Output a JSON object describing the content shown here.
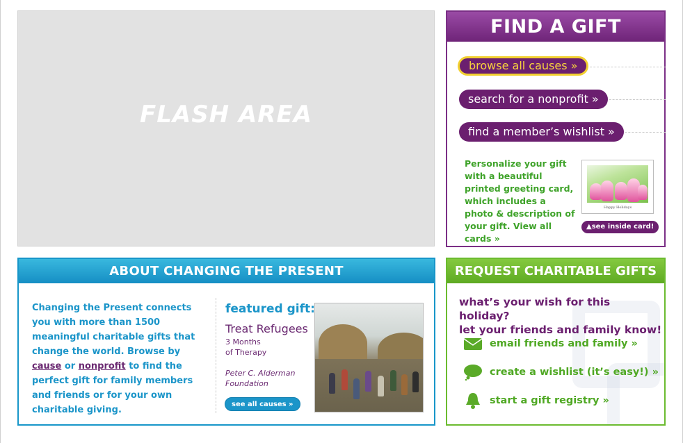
{
  "flash": {
    "label": "FLASH AREA"
  },
  "find_gift": {
    "title": "FIND A GIFT",
    "buttons": [
      "browse all causes »",
      "search for a nonprofit »",
      "find a member’s wishlist »"
    ],
    "card_text": "Personalize your gift with a beautiful printed greeting card, which includes a photo & description of your gift.",
    "card_link": "View all cards »",
    "card_caption": "Happy Holidays",
    "inside_card_label": "▲see inside card!"
  },
  "about": {
    "title": "ABOUT CHANGING THE PRESENT",
    "text_part1": "Changing the Present connects you with more than 1500 meaningful charitable gifts that change the world. Browse by",
    "link_cause": "cause",
    "text_or": "or",
    "link_nonprofit": "nonprofit",
    "text_part2": "to find the perfect gift for family members and friends or for your own charitable giving.",
    "featured_label": "featured gift:",
    "featured_name": "Treat Refugees",
    "featured_sub1": "3 Months",
    "featured_sub2": "of Therapy",
    "featured_org1": "Peter C. Alderman",
    "featured_org2": "Foundation",
    "see_all_label": "see all causes »"
  },
  "request": {
    "title": "REQUEST CHARITABLE GIFTS",
    "question_line1": "what’s your wish for this holiday?",
    "question_line2": "let your friends and family know!",
    "items": [
      {
        "label": "email friends and family »",
        "icon": "envelope-icon"
      },
      {
        "label": "create a wishlist (it’s easy!) »",
        "icon": "speech-bubble-icon"
      },
      {
        "label": "start a gift registry »",
        "icon": "bell-icon"
      }
    ]
  },
  "colors": {
    "purple": "#6b1f6f",
    "blue": "#1b95c9",
    "green": "#4fa823",
    "yellow": "#f2d030"
  }
}
